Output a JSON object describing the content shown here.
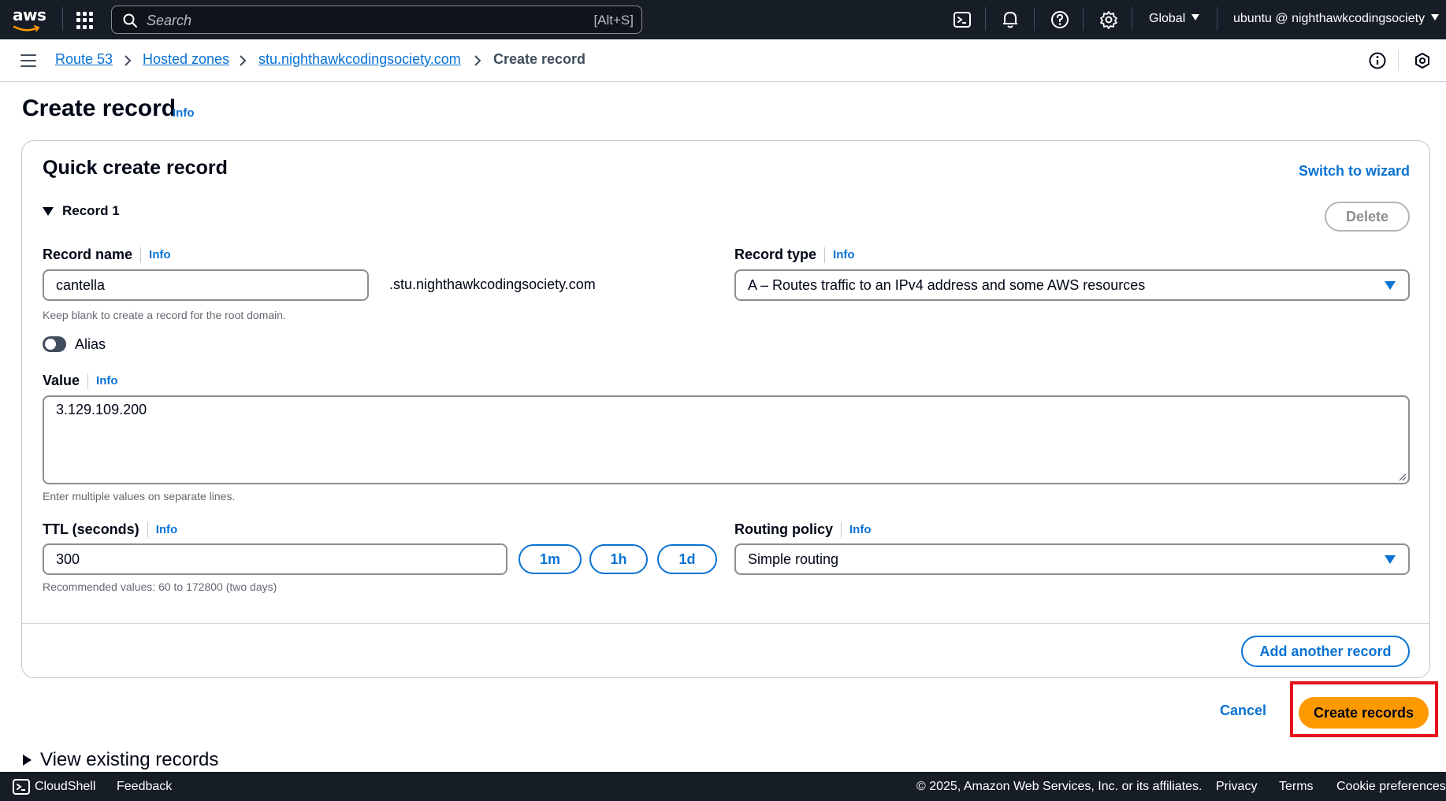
{
  "topnav": {
    "logo": "aws",
    "search_placeholder": "Search",
    "search_shortcut": "[Alt+S]",
    "region": "Global",
    "account": "ubuntu @ nighthawkcodingsociety",
    "icons": [
      "cloudshell-icon",
      "bell-icon",
      "help-icon",
      "settings-icon"
    ]
  },
  "breadcrumb": {
    "items": [
      "Route 53",
      "Hosted zones",
      "stu.nighthawkcodingsociety.com"
    ],
    "current": "Create record"
  },
  "page": {
    "title": "Create record",
    "info": "Info"
  },
  "quick_create": {
    "title": "Quick create record",
    "switch_wizard": "Switch to wizard",
    "record_label": "Record 1",
    "delete_label": "Delete",
    "record_name": {
      "label": "Record name",
      "info": "Info",
      "value": "cantella",
      "suffix": ".stu.nighthawkcodingsociety.com",
      "hint": "Keep blank to create a record for the root domain."
    },
    "record_type": {
      "label": "Record type",
      "info": "Info",
      "value": "A – Routes traffic to an IPv4 address and some AWS resources"
    },
    "alias": {
      "label": "Alias",
      "enabled": false
    },
    "value": {
      "label": "Value",
      "info": "Info",
      "text": "3.129.109.200",
      "hint": "Enter multiple values on separate lines."
    },
    "ttl": {
      "label": "TTL (seconds)",
      "info": "Info",
      "value": "300",
      "hint": "Recommended values: 60 to 172800 (two days)",
      "presets": [
        "1m",
        "1h",
        "1d"
      ]
    },
    "routing_policy": {
      "label": "Routing policy",
      "info": "Info",
      "value": "Simple routing"
    },
    "add_another": "Add another record"
  },
  "actions": {
    "cancel": "Cancel",
    "create": "Create records"
  },
  "view_existing": "View existing records",
  "footer": {
    "cloudshell": "CloudShell",
    "feedback": "Feedback",
    "copyright": "© 2025, Amazon Web Services, Inc. or its affiliates.",
    "privacy": "Privacy",
    "terms": "Terms",
    "cookies": "Cookie preferences"
  },
  "colors": {
    "nav_bg": "#161d26",
    "link": "#0972d3",
    "primary_button": "#ff9900",
    "highlight": "#e8101e"
  }
}
